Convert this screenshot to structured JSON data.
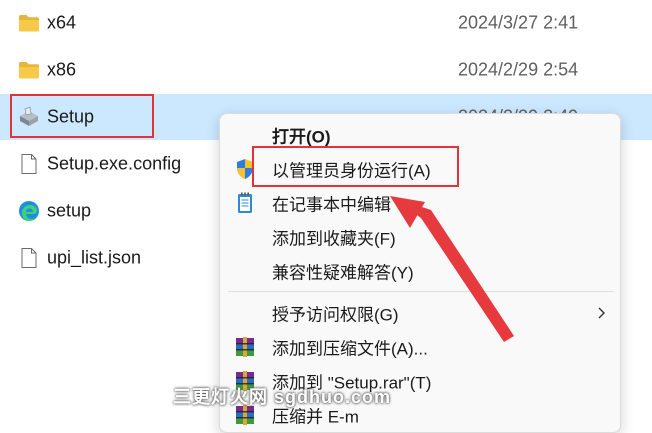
{
  "file_list": [
    {
      "name": "x64",
      "date": "2024/3/27 2:41",
      "icon": "folder-icon"
    },
    {
      "name": "x86",
      "date": "2024/2/29 2:54",
      "icon": "folder-icon"
    },
    {
      "name": "Setup",
      "date": "2024/2/29 2:49",
      "icon": "installer-icon",
      "selected": true
    },
    {
      "name": "Setup.exe.config",
      "date": "",
      "icon": "file-icon"
    },
    {
      "name": "setup",
      "date": "",
      "icon": "edge-icon"
    },
    {
      "name": "upi_list.json",
      "date": "",
      "icon": "file-icon"
    }
  ],
  "context_menu": {
    "items": [
      {
        "label": "打开(O)",
        "bold": true,
        "icon": "none"
      },
      {
        "label": "以管理员身份运行(A)",
        "icon": "shield-icon"
      },
      {
        "label": "在记事本中编辑",
        "icon": "notepad-icon"
      },
      {
        "label": "添加到收藏夹(F)",
        "icon": "none"
      },
      {
        "label": "兼容性疑难解答(Y)",
        "icon": "none"
      },
      {
        "label": "授予访问权限(G)",
        "icon": "none",
        "submenu": true
      },
      {
        "label": "添加到压缩文件(A)...",
        "icon": "winrar-icon"
      },
      {
        "label": "添加到 \"Setup.rar\"(T)",
        "icon": "winrar-icon"
      },
      {
        "label": "压缩并 E-m",
        "icon": "winrar-icon"
      }
    ]
  },
  "annotation": {
    "arrow_color": "#e63a3f",
    "box_color": "#e0343a"
  },
  "watermark": "三更灯火网 sgdhuo.com"
}
